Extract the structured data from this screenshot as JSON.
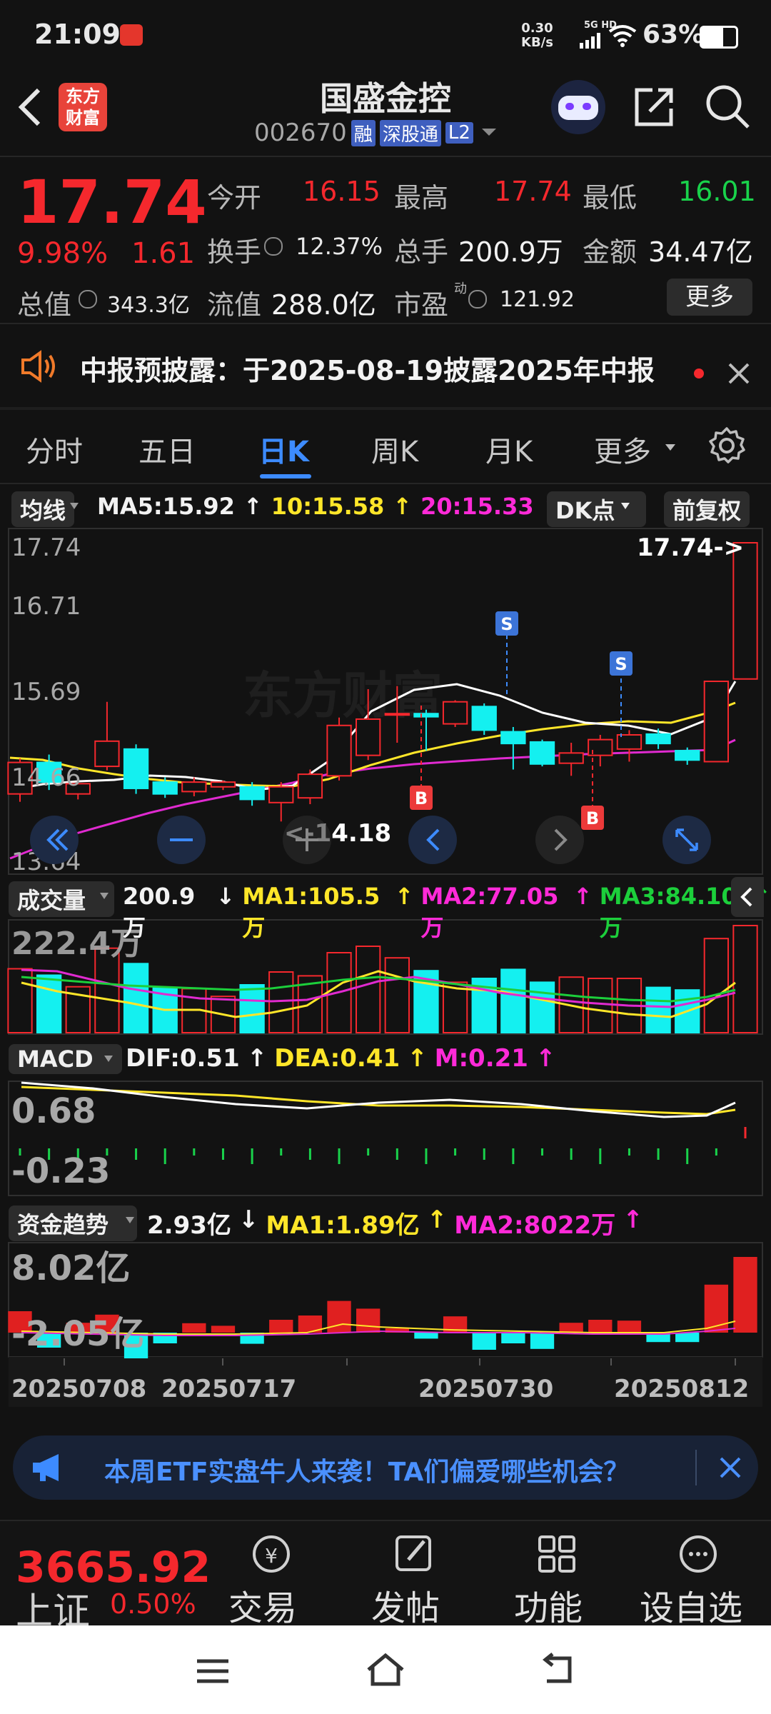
{
  "status": {
    "time": "21:09",
    "net_speed": "0.30",
    "net_unit": "KB/s",
    "net_type": "5G HD",
    "battery": "63%"
  },
  "header": {
    "app_logo_line1": "东方",
    "app_logo_line2": "财富",
    "title": "国盛金控",
    "code": "002670",
    "tags": [
      "融",
      "深股通",
      "L2"
    ]
  },
  "quote": {
    "price": "17.74",
    "change_pct": "9.98%",
    "change": "1.61",
    "open_label": "今开",
    "open": "16.15",
    "high_label": "最高",
    "high": "17.74",
    "low_label": "最低",
    "low": "16.01",
    "turnover_label": "换手",
    "turnover": "12.37%",
    "volume_label": "总手",
    "volume": "200.9万",
    "amount_label": "金额",
    "amount": "34.47亿",
    "mcap_label": "总值",
    "mcap": "343.3亿",
    "float_label": "流值",
    "float": "288.0亿",
    "pe_label": "市盈",
    "pe_sup": "动",
    "pe": "121.92",
    "more_label": "更多"
  },
  "notice": {
    "text": "中报预披露：于2025-08-19披露2025年中报"
  },
  "tabs": [
    "分时",
    "五日",
    "日K",
    "周K",
    "月K",
    "更多"
  ],
  "active_tab": 2,
  "kchart": {
    "ma_chip": "均线",
    "ma5": "MA5:15.92",
    "ma10": "10:15.58",
    "ma20": "20:15.33",
    "dk_chip": "DK点",
    "adjust_chip": "前复权",
    "price_labels": [
      "17.74",
      "16.71",
      "15.69",
      "14.66",
      "13.64"
    ],
    "high_tag": "17.74->",
    "low_tag": "<-14.18",
    "buy_label": "B",
    "sell_label": "S"
  },
  "volume": {
    "chip": "成交量",
    "value": "200.9万",
    "ma1": "MA1:105.5万",
    "ma2": "MA2:77.05万",
    "ma3": "MA3:84.10万",
    "max_label": "222.4万"
  },
  "macd": {
    "chip": "MACD",
    "dif": "DIF:0.51",
    "dea": "DEA:0.41",
    "m": "M:0.21",
    "top": "0.68",
    "bottom": "-0.23"
  },
  "fund": {
    "chip": "资金趋势",
    "value": "2.93亿",
    "ma1": "MA1:1.89亿",
    "ma2": "MA2:8022万",
    "top": "8.02亿",
    "bottom": "-2.05亿"
  },
  "dates": [
    "20250708",
    "20250717",
    "20250730",
    "20250812"
  ],
  "banner": {
    "text": "本周ETF实盘牛人来袭！TA们偏爱哪些机会？"
  },
  "bottom": {
    "index_value": "3665.92",
    "index_name": "上证",
    "index_change": "0.50%",
    "items": [
      "交易",
      "发帖",
      "功能",
      "设自选"
    ]
  },
  "chart_data": {
    "type": "candlestick",
    "ylim": [
      13.64,
      17.74
    ],
    "candles": [
      {
        "o": 14.55,
        "c": 14.95,
        "h": 15.0,
        "l": 14.45
      },
      {
        "o": 14.95,
        "c": 14.7,
        "h": 15.05,
        "l": 14.6
      },
      {
        "o": 14.55,
        "c": 14.68,
        "h": 14.75,
        "l": 14.48
      },
      {
        "o": 14.9,
        "c": 15.22,
        "h": 15.72,
        "l": 14.85
      },
      {
        "o": 15.12,
        "c": 14.62,
        "h": 15.18,
        "l": 14.55
      },
      {
        "o": 14.7,
        "c": 14.55,
        "h": 14.76,
        "l": 14.5
      },
      {
        "o": 14.58,
        "c": 14.7,
        "h": 14.76,
        "l": 14.52
      },
      {
        "o": 14.64,
        "c": 14.7,
        "h": 14.72,
        "l": 14.6
      },
      {
        "o": 14.64,
        "c": 14.48,
        "h": 14.7,
        "l": 14.4
      },
      {
        "o": 14.44,
        "c": 14.64,
        "h": 14.7,
        "l": 14.2
      },
      {
        "o": 14.5,
        "c": 14.8,
        "h": 14.86,
        "l": 14.42
      },
      {
        "o": 14.78,
        "c": 15.42,
        "h": 15.52,
        "l": 14.72
      },
      {
        "o": 15.04,
        "c": 15.5,
        "h": 15.88,
        "l": 14.98
      },
      {
        "o": 15.57,
        "c": 15.57,
        "h": 15.92,
        "l": 15.2
      },
      {
        "o": 15.57,
        "c": 15.53,
        "h": 15.62,
        "l": 15.1
      },
      {
        "o": 15.44,
        "c": 15.72,
        "h": 15.74,
        "l": 15.4
      },
      {
        "o": 15.66,
        "c": 15.36,
        "h": 15.7,
        "l": 15.3
      },
      {
        "o": 15.34,
        "c": 15.19,
        "h": 15.4,
        "l": 14.86
      },
      {
        "o": 15.21,
        "c": 14.93,
        "h": 15.24,
        "l": 14.9
      },
      {
        "o": 14.94,
        "c": 15.07,
        "h": 15.2,
        "l": 14.78
      },
      {
        "o": 15.04,
        "c": 15.24,
        "h": 15.3,
        "l": 14.9
      },
      {
        "o": 15.12,
        "c": 15.3,
        "h": 15.36,
        "l": 14.96
      },
      {
        "o": 15.31,
        "c": 15.19,
        "h": 15.38,
        "l": 15.12
      },
      {
        "o": 15.1,
        "c": 14.98,
        "h": 15.14,
        "l": 14.92
      },
      {
        "o": 14.96,
        "c": 15.98,
        "h": 15.98,
        "l": 14.96
      },
      {
        "o": 16.01,
        "c": 17.74,
        "h": 17.74,
        "l": 16.01
      }
    ]
  }
}
